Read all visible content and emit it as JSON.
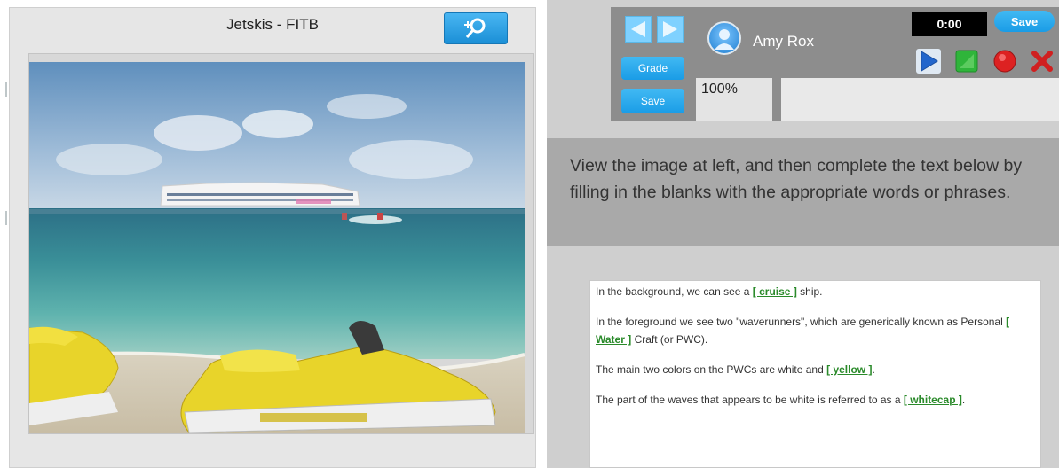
{
  "image_panel": {
    "title": "Jetskis - FITB",
    "zoom_icon": "zoom-in-icon"
  },
  "toolbar": {
    "prev_icon": "arrow-left-icon",
    "next_icon": "arrow-right-icon",
    "grade_label": "Grade",
    "save_label": "Save",
    "user_name": "Amy Rox",
    "avatar_icon": "user-avatar-icon",
    "progress": "100%",
    "timer": "0:00",
    "record_save_label": "Save",
    "controls": [
      "play-icon",
      "stop-icon",
      "record-icon",
      "delete-icon"
    ]
  },
  "instructions": "View the image at left, and then complete the text below by filling in the blanks with the appropriate words or phrases.",
  "passage": {
    "p1_before": "In the background, we can see a ",
    "p1_blank": "[ cruise ]",
    "p1_after": " ship.",
    "p2_before": "In the foreground we see two \"waverunners\", which are generically known as Personal ",
    "p2_blank": "[ Water ]",
    "p2_after": " Craft (or PWC).",
    "p3_before": "The main two colors on the PWCs are white and ",
    "p3_blank": "[ yellow ]",
    "p3_after": ".",
    "p4_before": "The part of the waves that appears to be white is referred to as a ",
    "p4_blank": "[ whitecap ]",
    "p4_after": "."
  },
  "colors": {
    "accent_blue": "#1a9ce6",
    "blank_green": "#2a8a2a"
  }
}
